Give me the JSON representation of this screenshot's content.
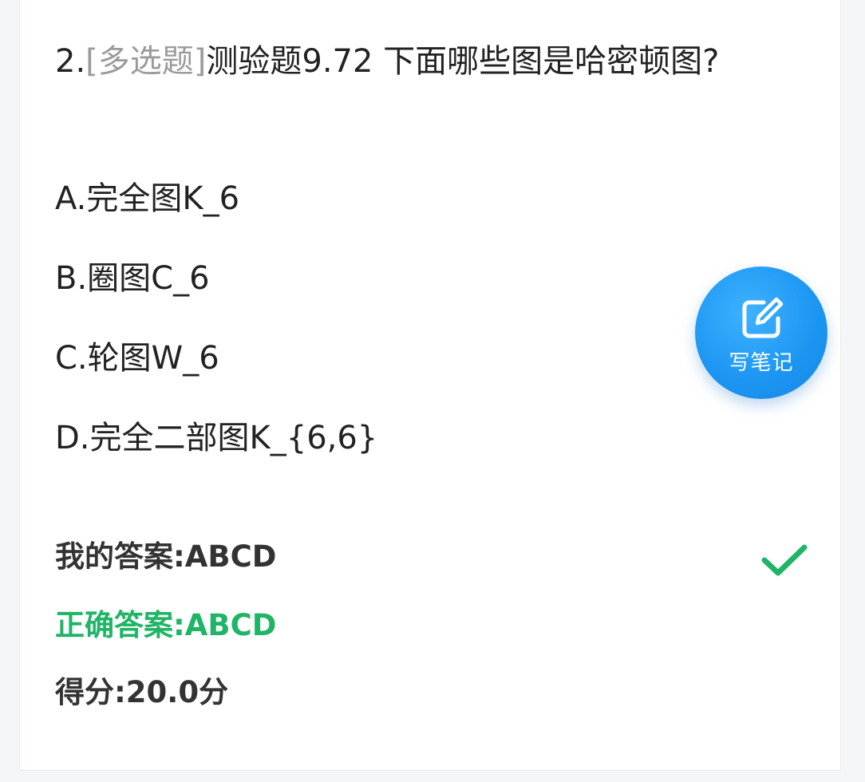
{
  "question": {
    "number": "2.",
    "type_label": "[多选题]",
    "text": "测验题9.72 下面哪些图是哈密顿图?"
  },
  "options": [
    {
      "label": "A.完全图K_6"
    },
    {
      "label": "B.圈图C_6"
    },
    {
      "label": "C.轮图W_6"
    },
    {
      "label": "D.完全二部图K_{6,6}"
    }
  ],
  "my_answer": {
    "label": "我的答案:",
    "value": "ABCD",
    "status_icon": "check-icon",
    "status_color": "#1fb466"
  },
  "correct_answer": {
    "label": "正确答案:",
    "value": "ABCD",
    "color": "#1fb466"
  },
  "score": {
    "label": "得分:",
    "value": "20.0分"
  },
  "note_button": {
    "label": "写笔记",
    "icon": "edit-note-icon",
    "color": "#1b95f2"
  }
}
